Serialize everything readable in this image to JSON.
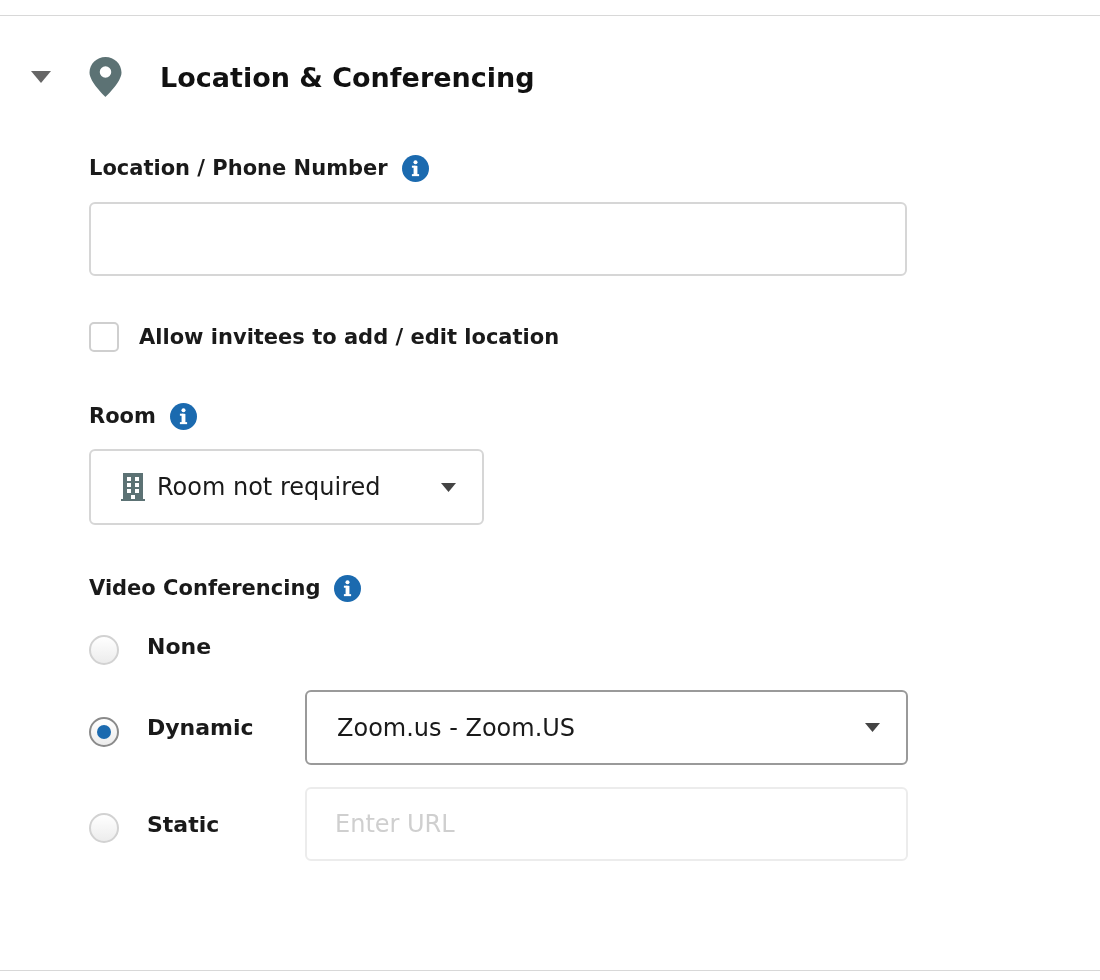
{
  "section": {
    "title": "Location & Conferencing",
    "expanded": true
  },
  "location": {
    "label": "Location / Phone Number"
  },
  "allow_edit": {
    "label": "Allow invitees to add / edit location",
    "checked": false
  },
  "room": {
    "label": "Room",
    "value": "Room not required"
  },
  "video": {
    "label": "Video Conferencing",
    "options": [
      {
        "label": "None",
        "selected": false,
        "kind": "none"
      },
      {
        "label": "Dynamic",
        "selected": true,
        "kind": "select",
        "value": "Zoom.us - Zoom.US"
      },
      {
        "label": "Static",
        "selected": false,
        "kind": "input",
        "placeholder": "Enter URL"
      }
    ]
  }
}
